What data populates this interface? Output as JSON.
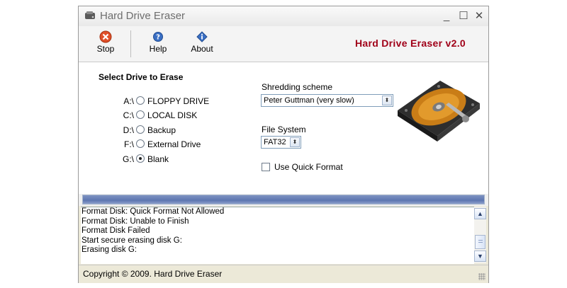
{
  "window": {
    "title": "Hard Drive Eraser",
    "controls": {
      "minimize": "_",
      "maximize": "☐",
      "close": "✕"
    }
  },
  "toolbar": {
    "stop_label": "Stop",
    "help_label": "Help",
    "about_label": "About",
    "brand": "Hard Drive Eraser v2.0"
  },
  "drives": {
    "section_title": "Select Drive to Erase",
    "items": [
      {
        "letter": "A:\\",
        "label": "FLOPPY DRIVE",
        "selected": false
      },
      {
        "letter": "C:\\",
        "label": "LOCAL DISK",
        "selected": false
      },
      {
        "letter": "D:\\",
        "label": "Backup",
        "selected": false
      },
      {
        "letter": "F:\\",
        "label": "External Drive",
        "selected": false
      },
      {
        "letter": "G:\\",
        "label": "Blank",
        "selected": true
      }
    ]
  },
  "shredding": {
    "label": "Shredding scheme",
    "value": "Peter Guttman (very slow)"
  },
  "filesystem": {
    "label": "File System",
    "value": "FAT32"
  },
  "quick_format": {
    "label": "Use Quick Format",
    "checked": false
  },
  "progress": {
    "value": 1.0
  },
  "log": {
    "lines": [
      "Format Disk: Quick Format Not Allowed",
      "Format Disk: Unable to Finish",
      "Format Disk Failed",
      "Start secure erasing disk G:",
      "Erasing disk G:"
    ]
  },
  "status": {
    "text": "Copyright © 2009. Hard Drive Eraser"
  },
  "icons": {
    "stop": "stop-icon",
    "help": "help-icon",
    "about": "info-icon",
    "hdd": "hard-drive-image"
  },
  "colors": {
    "brand": "#a00018",
    "progress": "#5d76b0"
  }
}
